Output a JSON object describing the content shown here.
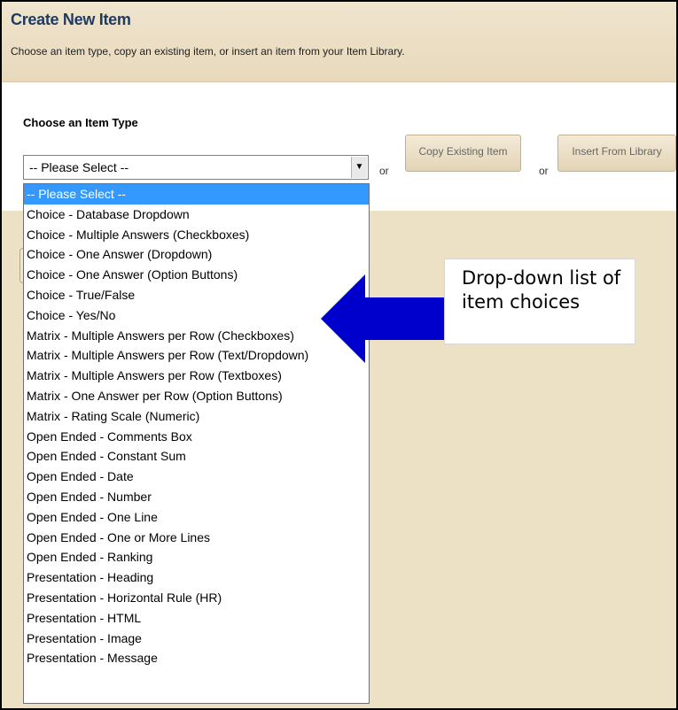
{
  "header": {
    "title": "Create New Item",
    "subtitle": "Choose an item type, copy an existing item, or insert an item from your Item Library."
  },
  "item_type": {
    "label": "Choose an Item Type",
    "selected_value": "-- Please Select --",
    "options": [
      "-- Please Select --",
      "Choice - Database Dropdown",
      "Choice - Multiple Answers (Checkboxes)",
      "Choice - One Answer (Dropdown)",
      "Choice - One Answer (Option Buttons)",
      "Choice - True/False",
      "Choice - Yes/No",
      "Matrix - Multiple Answers per Row (Checkboxes)",
      "Matrix - Multiple Answers per Row (Text/Dropdown)",
      "Matrix - Multiple Answers per Row (Textboxes)",
      "Matrix - One Answer per Row (Option Buttons)",
      "Matrix - Rating Scale (Numeric)",
      "Open Ended - Comments Box",
      "Open Ended - Constant Sum",
      "Open Ended - Date",
      "Open Ended - Number",
      "Open Ended - One Line",
      "Open Ended - One or More Lines",
      "Open Ended - Ranking",
      "Presentation - Heading",
      "Presentation - Horizontal Rule (HR)",
      "Presentation - HTML",
      "Presentation - Image",
      "Presentation - Message"
    ],
    "highlighted_index": 0
  },
  "actions": {
    "or_label": "or",
    "copy_existing_label": "Copy Existing Item",
    "insert_library_label": "Insert From Library"
  },
  "annotation": {
    "text": "Drop-down list of item choices",
    "arrow_color": "#0000cc"
  },
  "colors": {
    "header_bg": "#e8d9bc",
    "panel_bg": "#ece0c5",
    "title_color": "#1f3a5f",
    "selection_bg": "#3399ff"
  },
  "icons": {
    "select_arrow": "chevron-down-icon",
    "callout_arrow": "left-arrow-icon"
  }
}
